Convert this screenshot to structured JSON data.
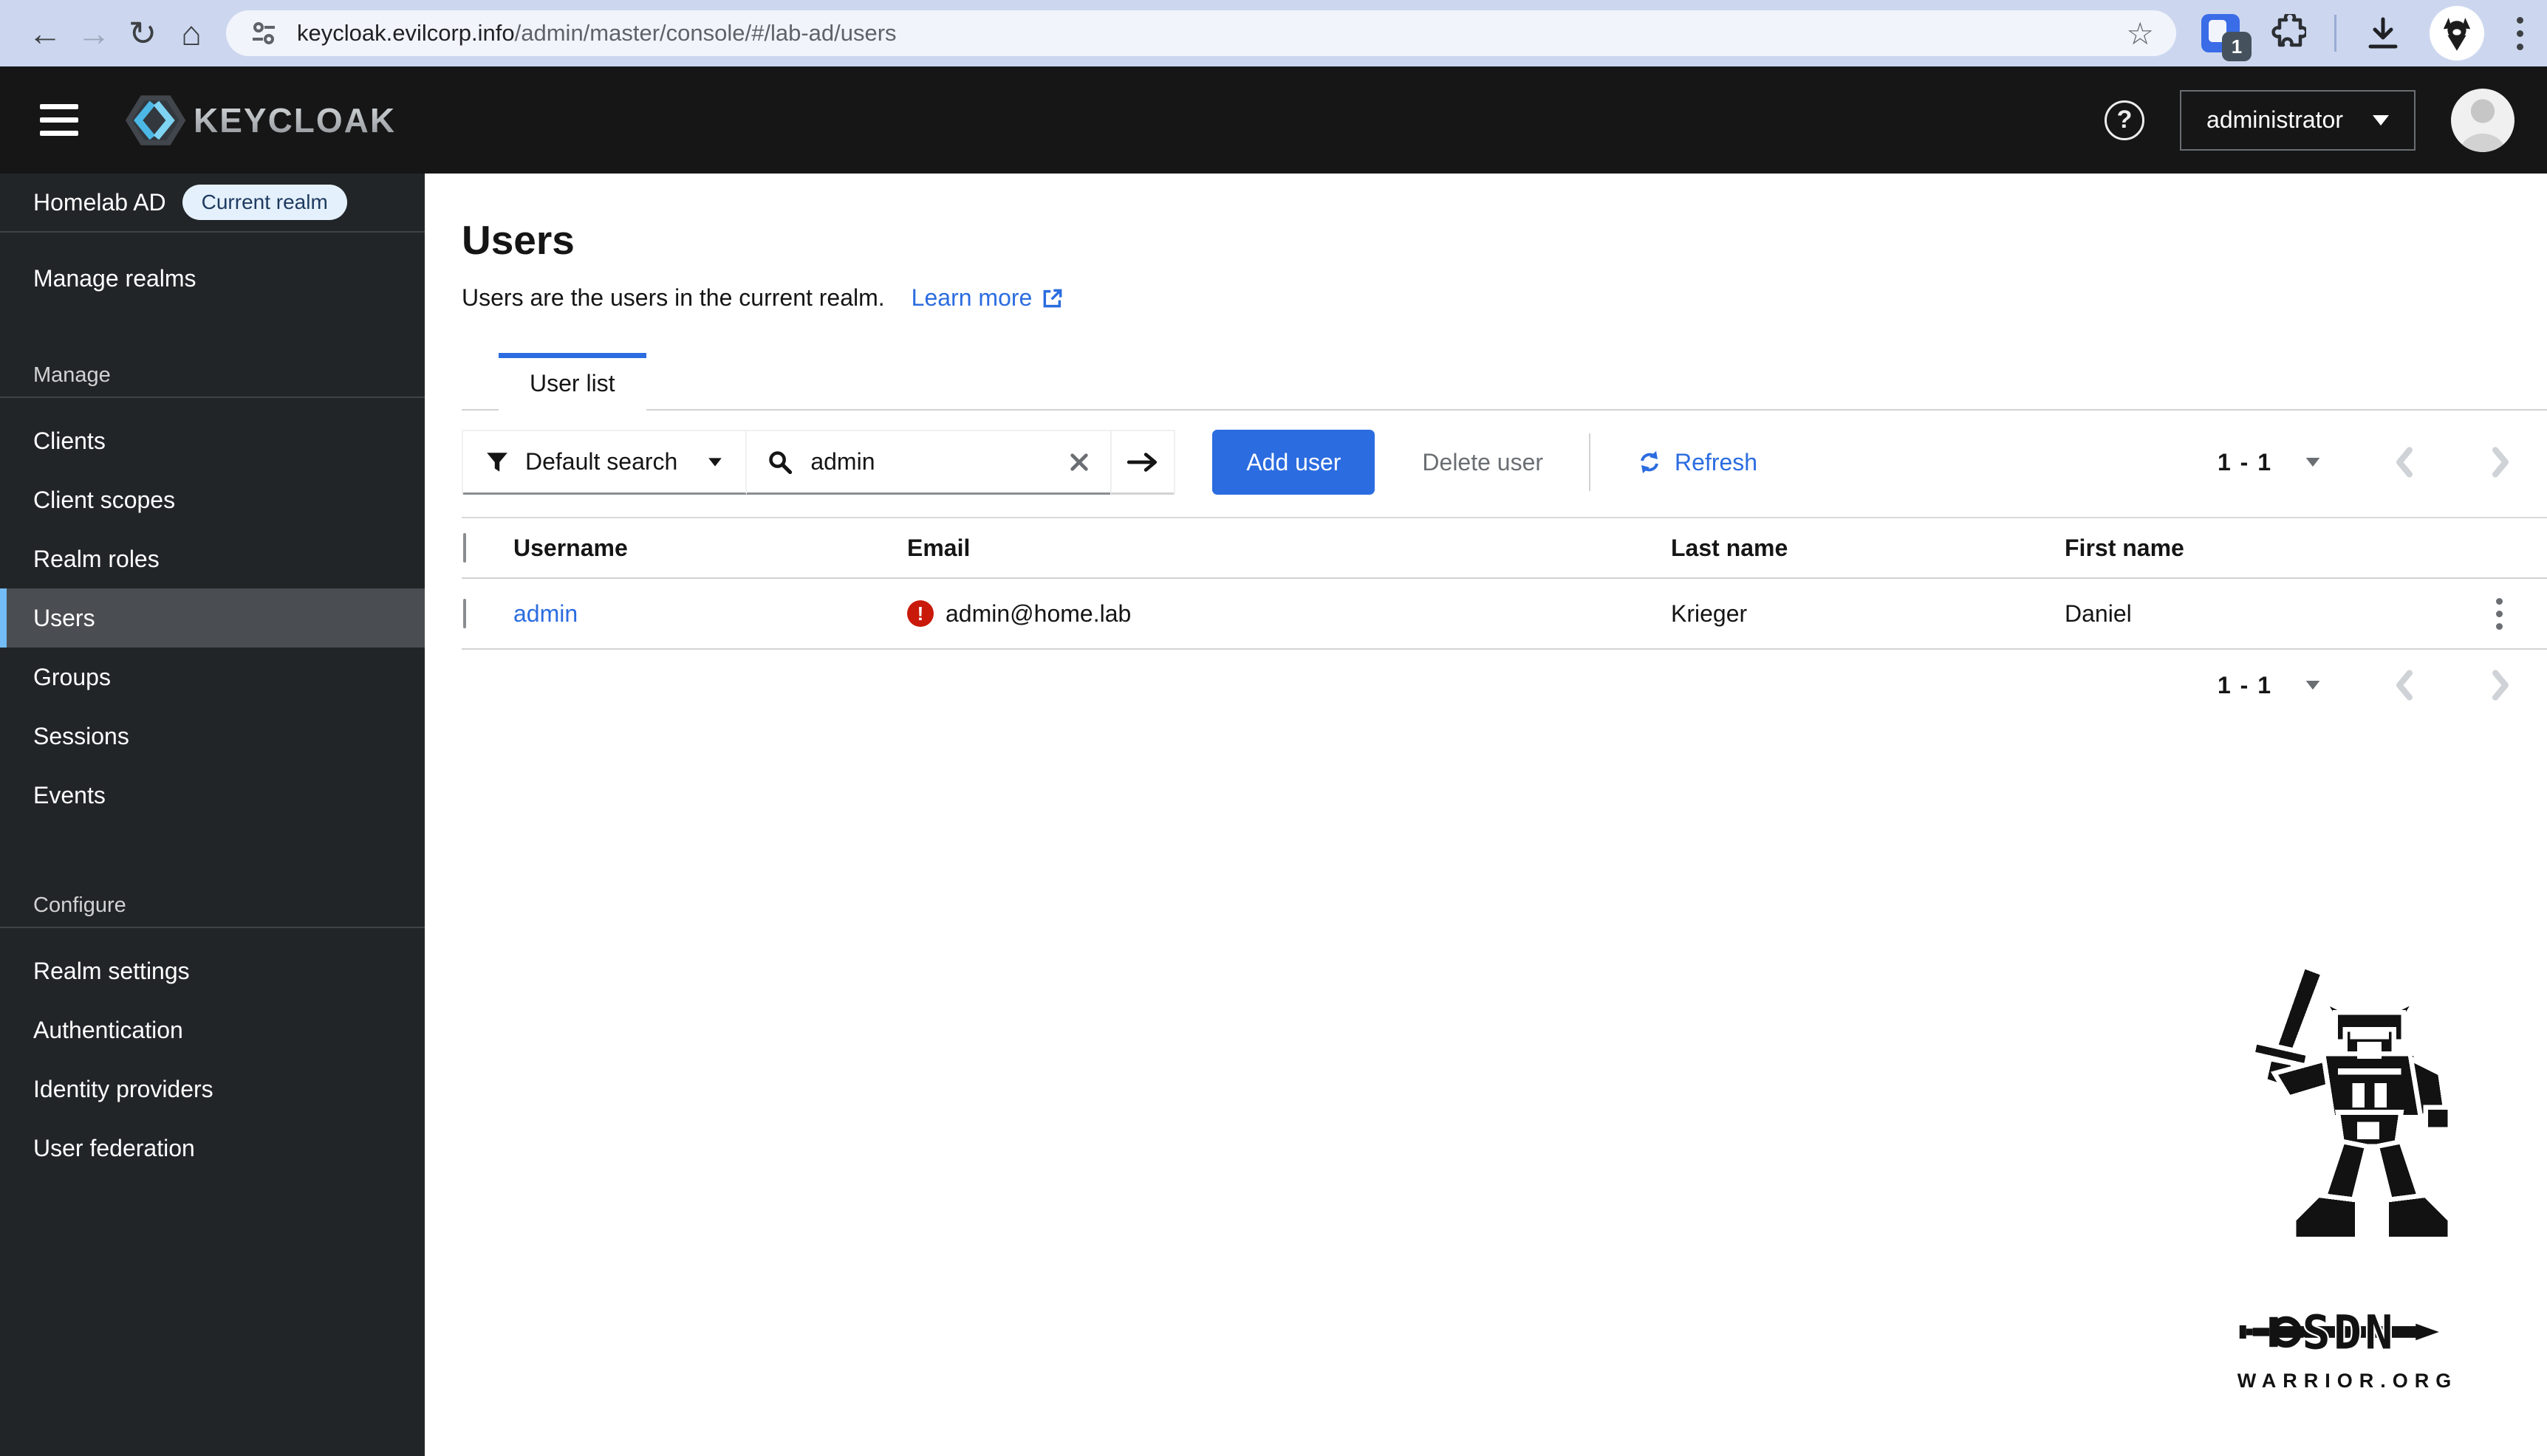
{
  "browser": {
    "url": "keycloak.evilcorp.info/admin/master/console/#/lab-ad/users",
    "url_domain": "keycloak.evilcorp.info",
    "url_path": "/admin/master/console/#/lab-ad/users",
    "extension_badge": "1"
  },
  "header": {
    "brand": "KEYCLOAK",
    "help_glyph": "?",
    "user_menu": "administrator"
  },
  "sidebar": {
    "realm_name": "Homelab AD",
    "realm_badge": "Current realm",
    "manage_realms": "Manage realms",
    "active_item": "Users",
    "sections": [
      {
        "label": "Manage",
        "items": [
          "Clients",
          "Client scopes",
          "Realm roles",
          "Users",
          "Groups",
          "Sessions",
          "Events"
        ]
      },
      {
        "label": "Configure",
        "items": [
          "Realm settings",
          "Authentication",
          "Identity providers",
          "User federation"
        ]
      }
    ]
  },
  "page": {
    "title": "Users",
    "description": "Users are the users in the current realm.",
    "learn_more": "Learn more",
    "tab": "User list",
    "toolbar": {
      "filter_label": "Default search",
      "search_value": "admin",
      "add_user": "Add user",
      "delete_user": "Delete user",
      "refresh": "Refresh"
    },
    "pagination_range": "1 - 1",
    "table": {
      "columns": [
        "Username",
        "Email",
        "Last name",
        "First name"
      ],
      "rows": [
        {
          "username": "admin",
          "email": "admin@home.lab",
          "email_invalid": true,
          "last_name": "Krieger",
          "first_name": "Daniel"
        }
      ]
    },
    "watermark": {
      "title": "SDN",
      "subtitle": "WARRIOR.ORG"
    }
  },
  "colors": {
    "accent": "#2b6ce0",
    "error": "#c9190b",
    "nav_active_accent": "#73bcf7",
    "badge_bg": "#e4f0fb",
    "badge_text": "#1d3a5f"
  }
}
